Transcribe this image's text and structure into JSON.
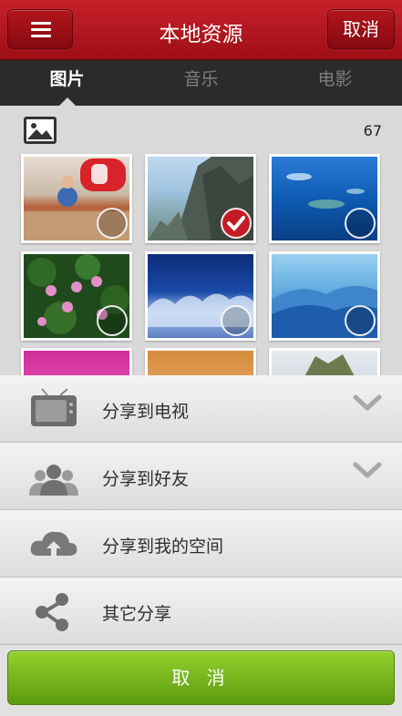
{
  "header": {
    "title": "本地资源",
    "cancel_label": "取消",
    "menu_icon": "hamburger-icon"
  },
  "tabs": [
    {
      "label": "图片",
      "active": true
    },
    {
      "label": "音乐",
      "active": false
    },
    {
      "label": "电影",
      "active": false
    }
  ],
  "gallery": {
    "count": "67",
    "images": [
      {
        "name": "red-toy-car-photo",
        "selected": false
      },
      {
        "name": "mountain-cliff-photo",
        "selected": true
      },
      {
        "name": "ocean-islands-photo",
        "selected": false
      },
      {
        "name": "lotus-pond-photo",
        "selected": false
      },
      {
        "name": "frosted-trees-photo",
        "selected": false
      },
      {
        "name": "blue-mountains-photo",
        "selected": false
      },
      {
        "name": "pink-sky-photo",
        "selected": false
      },
      {
        "name": "sunset-glow-photo",
        "selected": false
      },
      {
        "name": "rock-landscape-photo",
        "selected": false
      }
    ]
  },
  "share_menu": [
    {
      "label": "分享到电视",
      "icon": "tv-icon",
      "expandable": true
    },
    {
      "label": "分享到好友",
      "icon": "friends-icon",
      "expandable": true
    },
    {
      "label": "分享到我的空间",
      "icon": "cloud-upload-icon",
      "expandable": false
    },
    {
      "label": "其它分享",
      "icon": "share-icon",
      "expandable": false
    }
  ],
  "bottom": {
    "cancel_label": "取 消"
  },
  "colors": {
    "header_red": "#b01820",
    "tab_bar": "#2b2b2b",
    "cancel_green": "#7cb51f"
  }
}
